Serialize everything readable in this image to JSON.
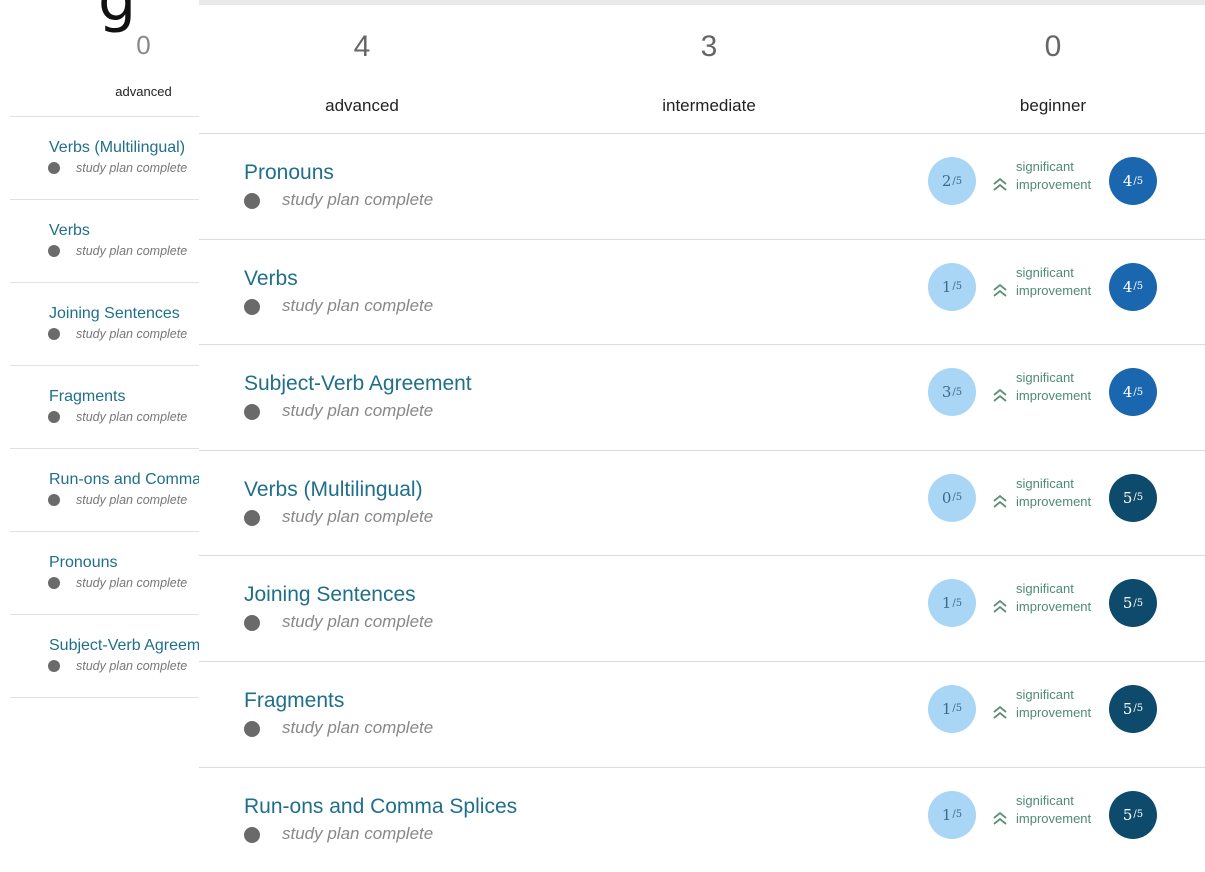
{
  "left_panel": {
    "count": "0",
    "level": "advanced",
    "items": [
      {
        "title": "Verbs (Multilingual)",
        "status": "study plan complete"
      },
      {
        "title": "Verbs",
        "status": "study plan complete"
      },
      {
        "title": "Joining Sentences",
        "status": "study plan complete"
      },
      {
        "title": "Fragments",
        "status": "study plan complete"
      },
      {
        "title": "Run-ons and Comma Splices",
        "status": "study plan complete"
      },
      {
        "title": "Pronouns",
        "status": "study plan complete"
      },
      {
        "title": "Subject-Verb Agreement",
        "status": "study plan complete"
      }
    ]
  },
  "main_panel": {
    "columns": [
      {
        "count": "4",
        "label": "advanced"
      },
      {
        "count": "3",
        "label": "intermediate"
      },
      {
        "count": "0",
        "label": "beginner"
      }
    ],
    "rows": [
      {
        "title": "Pronouns",
        "status": "study plan complete",
        "before": "2",
        "before_max": "/5",
        "improvement": "significant improvement",
        "after": "4",
        "after_max": "/5",
        "after_color": "blue"
      },
      {
        "title": "Verbs",
        "status": "study plan complete",
        "before": "1",
        "before_max": "/5",
        "improvement": "significant improvement",
        "after": "4",
        "after_max": "/5",
        "after_color": "blue"
      },
      {
        "title": "Subject-Verb Agreement",
        "status": "study plan complete",
        "before": "3",
        "before_max": "/5",
        "improvement": "significant improvement",
        "after": "4",
        "after_max": "/5",
        "after_color": "blue"
      },
      {
        "title": "Verbs (Multilingual)",
        "status": "study plan complete",
        "before": "0",
        "before_max": "/5",
        "improvement": "significant improvement",
        "after": "5",
        "after_max": "/5",
        "after_color": "navy"
      },
      {
        "title": "Joining Sentences",
        "status": "study plan complete",
        "before": "1",
        "before_max": "/5",
        "improvement": "significant improvement",
        "after": "5",
        "after_max": "/5",
        "after_color": "navy"
      },
      {
        "title": "Fragments",
        "status": "study plan complete",
        "before": "1",
        "before_max": "/5",
        "improvement": "significant improvement",
        "after": "5",
        "after_max": "/5",
        "after_color": "navy"
      },
      {
        "title": "Run-ons and Comma Splices",
        "status": "study plan complete",
        "before": "1",
        "before_max": "/5",
        "improvement": "significant improvement",
        "after": "5",
        "after_max": "/5",
        "after_color": "navy"
      }
    ]
  },
  "colors": {
    "topic_link": "#1f6f8b",
    "score_before_bg": "#a9d6f5",
    "score_after_blue": "#1a67b0",
    "score_after_navy": "#0d4a6b",
    "improvement_text": "#4f8a73"
  },
  "icons": {
    "improvement": "double-chevron-up-icon",
    "status": "status-dot-icon"
  }
}
